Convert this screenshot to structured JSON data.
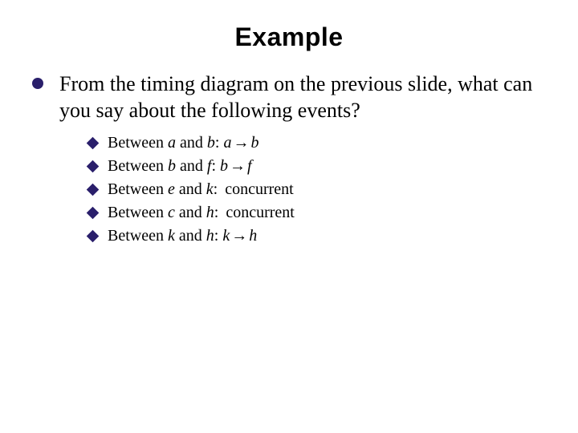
{
  "title": "Example",
  "main": {
    "text": "From the timing diagram on the previous slide, what can you say about the following events?"
  },
  "subs": [
    {
      "prefix": "Between ",
      "x": "a",
      "mid": " and ",
      "y": "b",
      "sep": ": ",
      "rel_lhs": "a",
      "rel_sym": "→",
      "rel_rhs": "b",
      "tail": ""
    },
    {
      "prefix": "Between ",
      "x": "b",
      "mid": " and ",
      "y": "f",
      "sep": ": ",
      "rel_lhs": "b",
      "rel_sym": "→",
      "rel_rhs": "f",
      "tail": ""
    },
    {
      "prefix": "Between ",
      "x": "e",
      "mid": " and ",
      "y": "k",
      "sep": ": ",
      "rel_lhs": "",
      "rel_sym": "",
      "rel_rhs": "",
      "tail": "concurrent"
    },
    {
      "prefix": "Between ",
      "x": "c",
      "mid": " and ",
      "y": "h",
      "sep": ": ",
      "rel_lhs": "",
      "rel_sym": "",
      "rel_rhs": "",
      "tail": "concurrent"
    },
    {
      "prefix": "Between ",
      "x": "k",
      "mid": " and ",
      "y": "h",
      "sep": ": ",
      "rel_lhs": "k",
      "rel_sym": "→",
      "rel_rhs": "h",
      "tail": ""
    }
  ]
}
